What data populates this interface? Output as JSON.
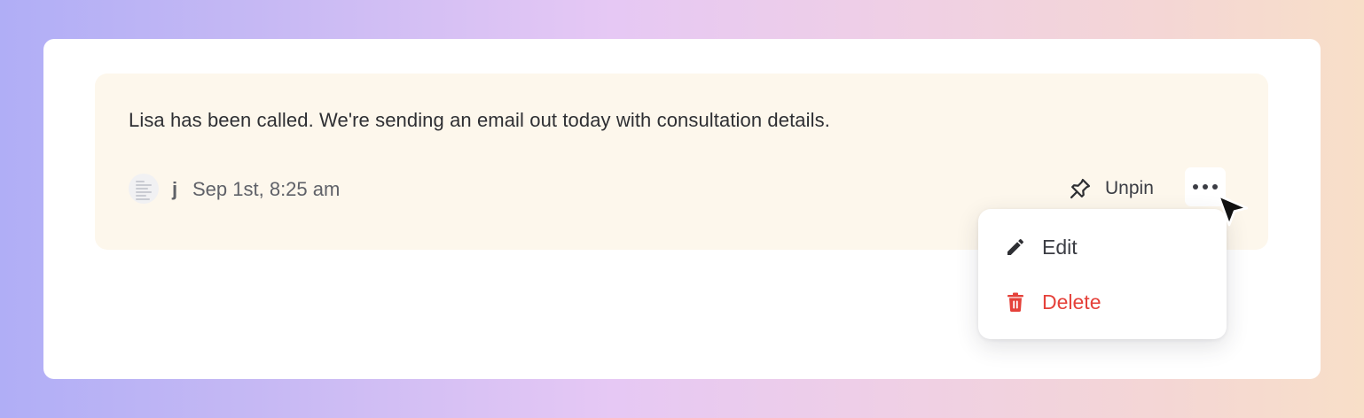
{
  "note": {
    "text": "Lisa has been called. We're sending an email out today with consultation details.",
    "author": "j",
    "timestamp": "Sep 1st, 8:25 am",
    "background_color": "#fdf7ec"
  },
  "actions": {
    "unpin_label": "Unpin",
    "unpin_icon": "pin-icon",
    "more_icon": "more-horizontal-icon"
  },
  "menu": {
    "items": [
      {
        "label": "Edit",
        "icon": "pencil-icon",
        "color": "#3b3d44"
      },
      {
        "label": "Delete",
        "icon": "trash-icon",
        "color": "#e5413a"
      }
    ]
  },
  "colors": {
    "danger": "#e5413a",
    "text_primary": "#2e2f33",
    "text_muted": "#5f6168"
  }
}
